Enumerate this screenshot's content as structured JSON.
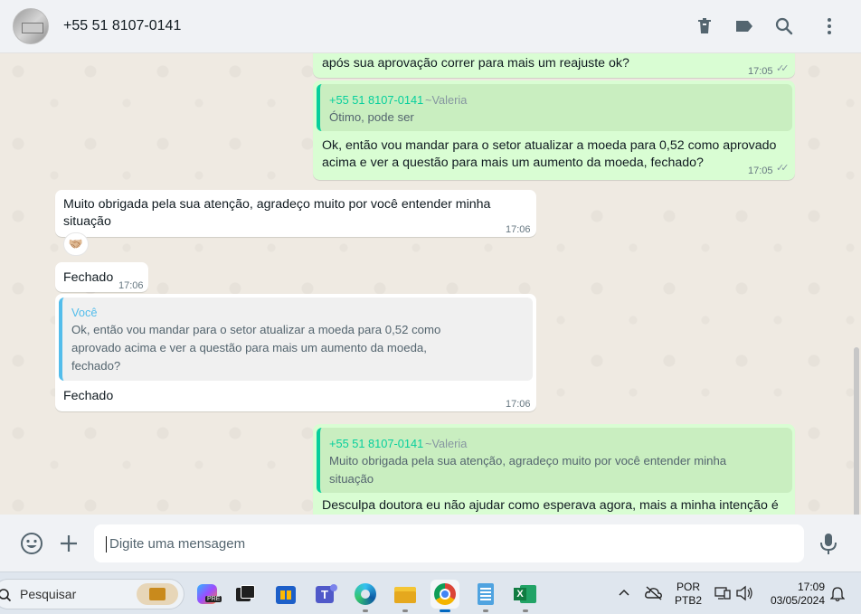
{
  "header": {
    "contact_name": "+55 51 8107-0141"
  },
  "messages": {
    "m1": {
      "text": "após sua aprovação correr para mais um reajuste ok?",
      "time": "17:05"
    },
    "m2": {
      "quote_author": "+55 51 8107-0141",
      "quote_alias": "~Valeria",
      "quote_text": "Ótimo, pode ser",
      "line1": "Ok, então vou mandar para o setor atualizar a moeda para 0,52 como aprovado",
      "line2": "acima e ver a questão para mais um aumento da moeda, fechado?",
      "time": "17:05"
    },
    "m3": {
      "line1": "Muito obrigada pela sua atenção, agradeço muito por você entender minha",
      "line2": "situação",
      "time": "17:06",
      "reaction": "🤝🏼"
    },
    "m4": {
      "text": "Fechado",
      "time": "17:06"
    },
    "m5": {
      "quote_author": "Você",
      "quote_line1": "Ok, então vou mandar para o setor atualizar a moeda para 0,52 como",
      "quote_line2": "aprovado acima e ver a questão para mais um aumento da moeda,",
      "quote_line3": "fechado?",
      "text": "Fechado",
      "time": "17:06"
    },
    "m6": {
      "quote_author": "+55 51 8107-0141",
      "quote_alias": "~Valeria",
      "quote_line1": "Muito obrigada pela sua atenção, agradeço muito por você entender minha",
      "quote_line2": "situação",
      "text": "Desculpa doutora eu não ajudar como esperava agora, mais a minha intenção é"
    }
  },
  "composer": {
    "placeholder": "Digite uma mensagem"
  },
  "taskbar": {
    "search_label": "Pesquisar",
    "language": "POR",
    "layout": "PTB2",
    "time": "17:09",
    "date": "03/05/2024"
  },
  "colors": {
    "outgoing_bubble": "#d9fdd3",
    "incoming_bubble": "#ffffff",
    "accent_green": "#06cf9c",
    "you_blue": "#53bdeb"
  },
  "icons": {
    "header": [
      "trash-icon",
      "label-icon",
      "search-icon",
      "menu-icon"
    ],
    "composer": [
      "emoji-icon",
      "attach-icon",
      "mic-icon"
    ]
  }
}
